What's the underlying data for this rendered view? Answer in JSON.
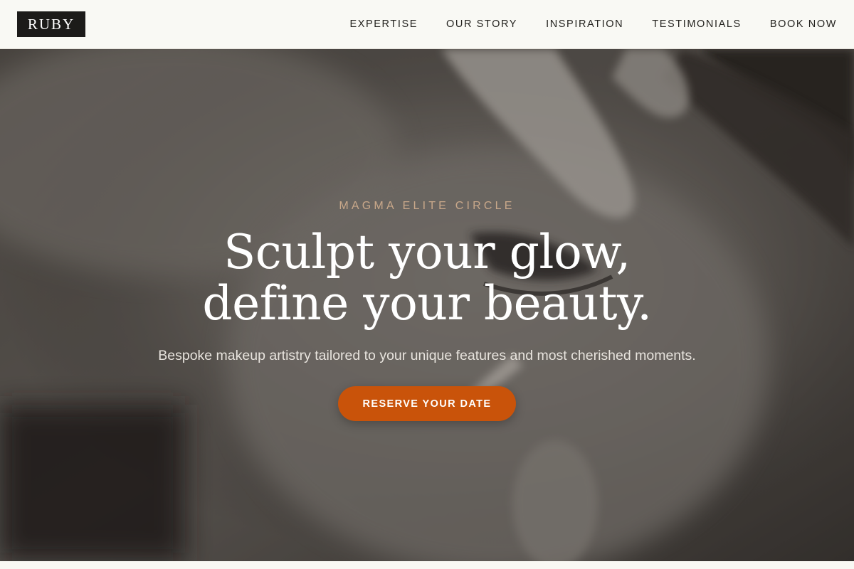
{
  "brand": {
    "logo_text": "RUBY"
  },
  "nav": {
    "items": [
      {
        "label": "EXPERTISE"
      },
      {
        "label": "OUR STORY"
      },
      {
        "label": "INSPIRATION"
      },
      {
        "label": "TESTIMONIALS"
      },
      {
        "label": "BOOK NOW"
      }
    ]
  },
  "hero": {
    "eyebrow": "MAGMA ELITE CIRCLE",
    "headline_line1": "Sculpt your glow,",
    "headline_line2": "define your beauty.",
    "subtext": "Bespoke makeup artistry tailored to your unique features and most cherished moments.",
    "cta_label": "RESERVE YOUR DATE"
  },
  "colors": {
    "accent": "#c9530a",
    "eyebrow": "#c9a88a",
    "header_bg": "#f9f9f4",
    "logo_bg": "#1c1b19"
  }
}
